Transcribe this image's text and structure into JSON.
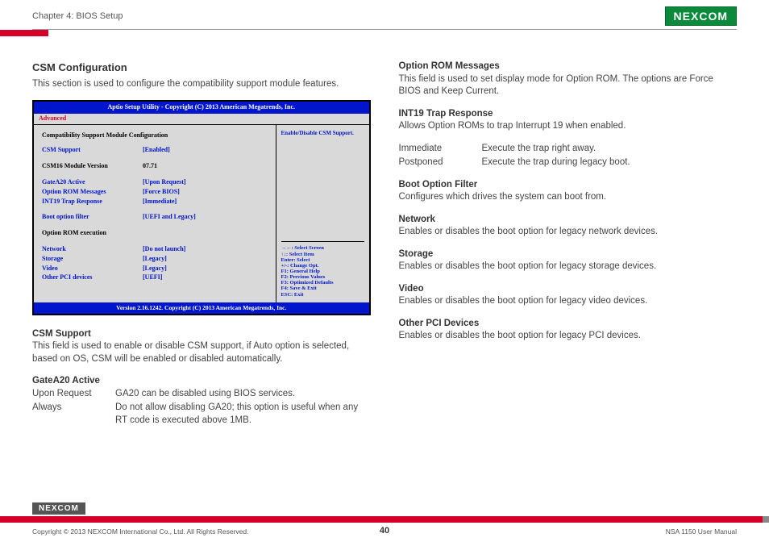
{
  "header": {
    "chapter": "Chapter 4: BIOS Setup",
    "brand": "NEXCOM"
  },
  "left": {
    "title": "CSM Configuration",
    "intro": "This section is used to configure the compatibility support module features.",
    "bios": {
      "header": "Aptio Setup Utility - Copyright (C) 2013 American Megatrends, Inc.",
      "tab": "Advanced",
      "section_title": "Compatibility Support Module Configuration",
      "rows": [
        {
          "label": "CSM Support",
          "value": "[Enabled]",
          "style": "blue"
        },
        {
          "label": "CSM16 Module Version",
          "value": "07.71",
          "style": "black"
        },
        {
          "label": "GateA20 Active",
          "value": "[Upon Request]",
          "style": "blue"
        },
        {
          "label": "Option ROM Messages",
          "value": "[Force BIOS]",
          "style": "blue"
        },
        {
          "label": "INT19 Trap Response",
          "value": "[Immediate]",
          "style": "blue"
        },
        {
          "label": "Boot option filter",
          "value": "[UEFI and Legacy]",
          "style": "blue"
        },
        {
          "label": "Option ROM execution",
          "value": "",
          "style": "black"
        },
        {
          "label": "Network",
          "value": "[Do not launch]",
          "style": "blue"
        },
        {
          "label": "Storage",
          "value": "[Legacy]",
          "style": "blue"
        },
        {
          "label": "Video",
          "value": "[Legacy]",
          "style": "blue"
        },
        {
          "label": "Other PCI devices",
          "value": "[UEFI]",
          "style": "blue"
        }
      ],
      "help_top": "Enable/Disable CSM Support.",
      "help_keys": [
        "→←: Select Screen",
        "↑↓: Select Item",
        "Enter: Select",
        "+/-: Change Opt.",
        "F1: General Help",
        "F2: Previous Values",
        "F3: Optimized Defaults",
        "F4: Save & Exit",
        "ESC: Exit"
      ],
      "footer": "Version 2.16.1242. Copyright (C) 2013 American Megatrends, Inc."
    },
    "csm_support_h": "CSM Support",
    "csm_support_p": "This field is used to enable or disable CSM support, if Auto option is selected, based on OS, CSM will be enabled or disabled automatically.",
    "gatea20_h": "GateA20 Active",
    "gatea20_rows": [
      {
        "k": "Upon Request",
        "v": "GA20 can be disabled using BIOS services."
      },
      {
        "k": "Always",
        "v": "Do not allow disabling GA20; this option is useful when any RT code is executed above 1MB."
      }
    ]
  },
  "right": {
    "optrom_h": "Option ROM Messages",
    "optrom_p": "This field is used to set display mode for Option ROM. The options are Force BIOS and Keep Current.",
    "int19_h": "INT19 Trap Response",
    "int19_p": "Allows Option ROMs to trap Interrupt 19 when enabled.",
    "int19_rows": [
      {
        "k": "Immediate",
        "v": "Execute the trap right away."
      },
      {
        "k": "Postponed",
        "v": "Execute the trap during legacy boot."
      }
    ],
    "boot_h": "Boot Option Filter",
    "boot_p": "Configures which drives the system can boot from.",
    "net_h": "Network",
    "net_p": "Enables or disables the boot option for legacy network devices.",
    "stor_h": "Storage",
    "stor_p": "Enables or disables the boot option for legacy storage devices.",
    "vid_h": "Video",
    "vid_p": "Enables or disables the boot option for legacy video devices.",
    "pci_h": "Other PCI Devices",
    "pci_p": "Enables or disables the boot option for legacy PCI devices."
  },
  "footer": {
    "copyright": "Copyright © 2013 NEXCOM International Co., Ltd. All Rights Reserved.",
    "page": "40",
    "doc": "NSA 1150 User Manual",
    "brand": "NEXCOM"
  }
}
